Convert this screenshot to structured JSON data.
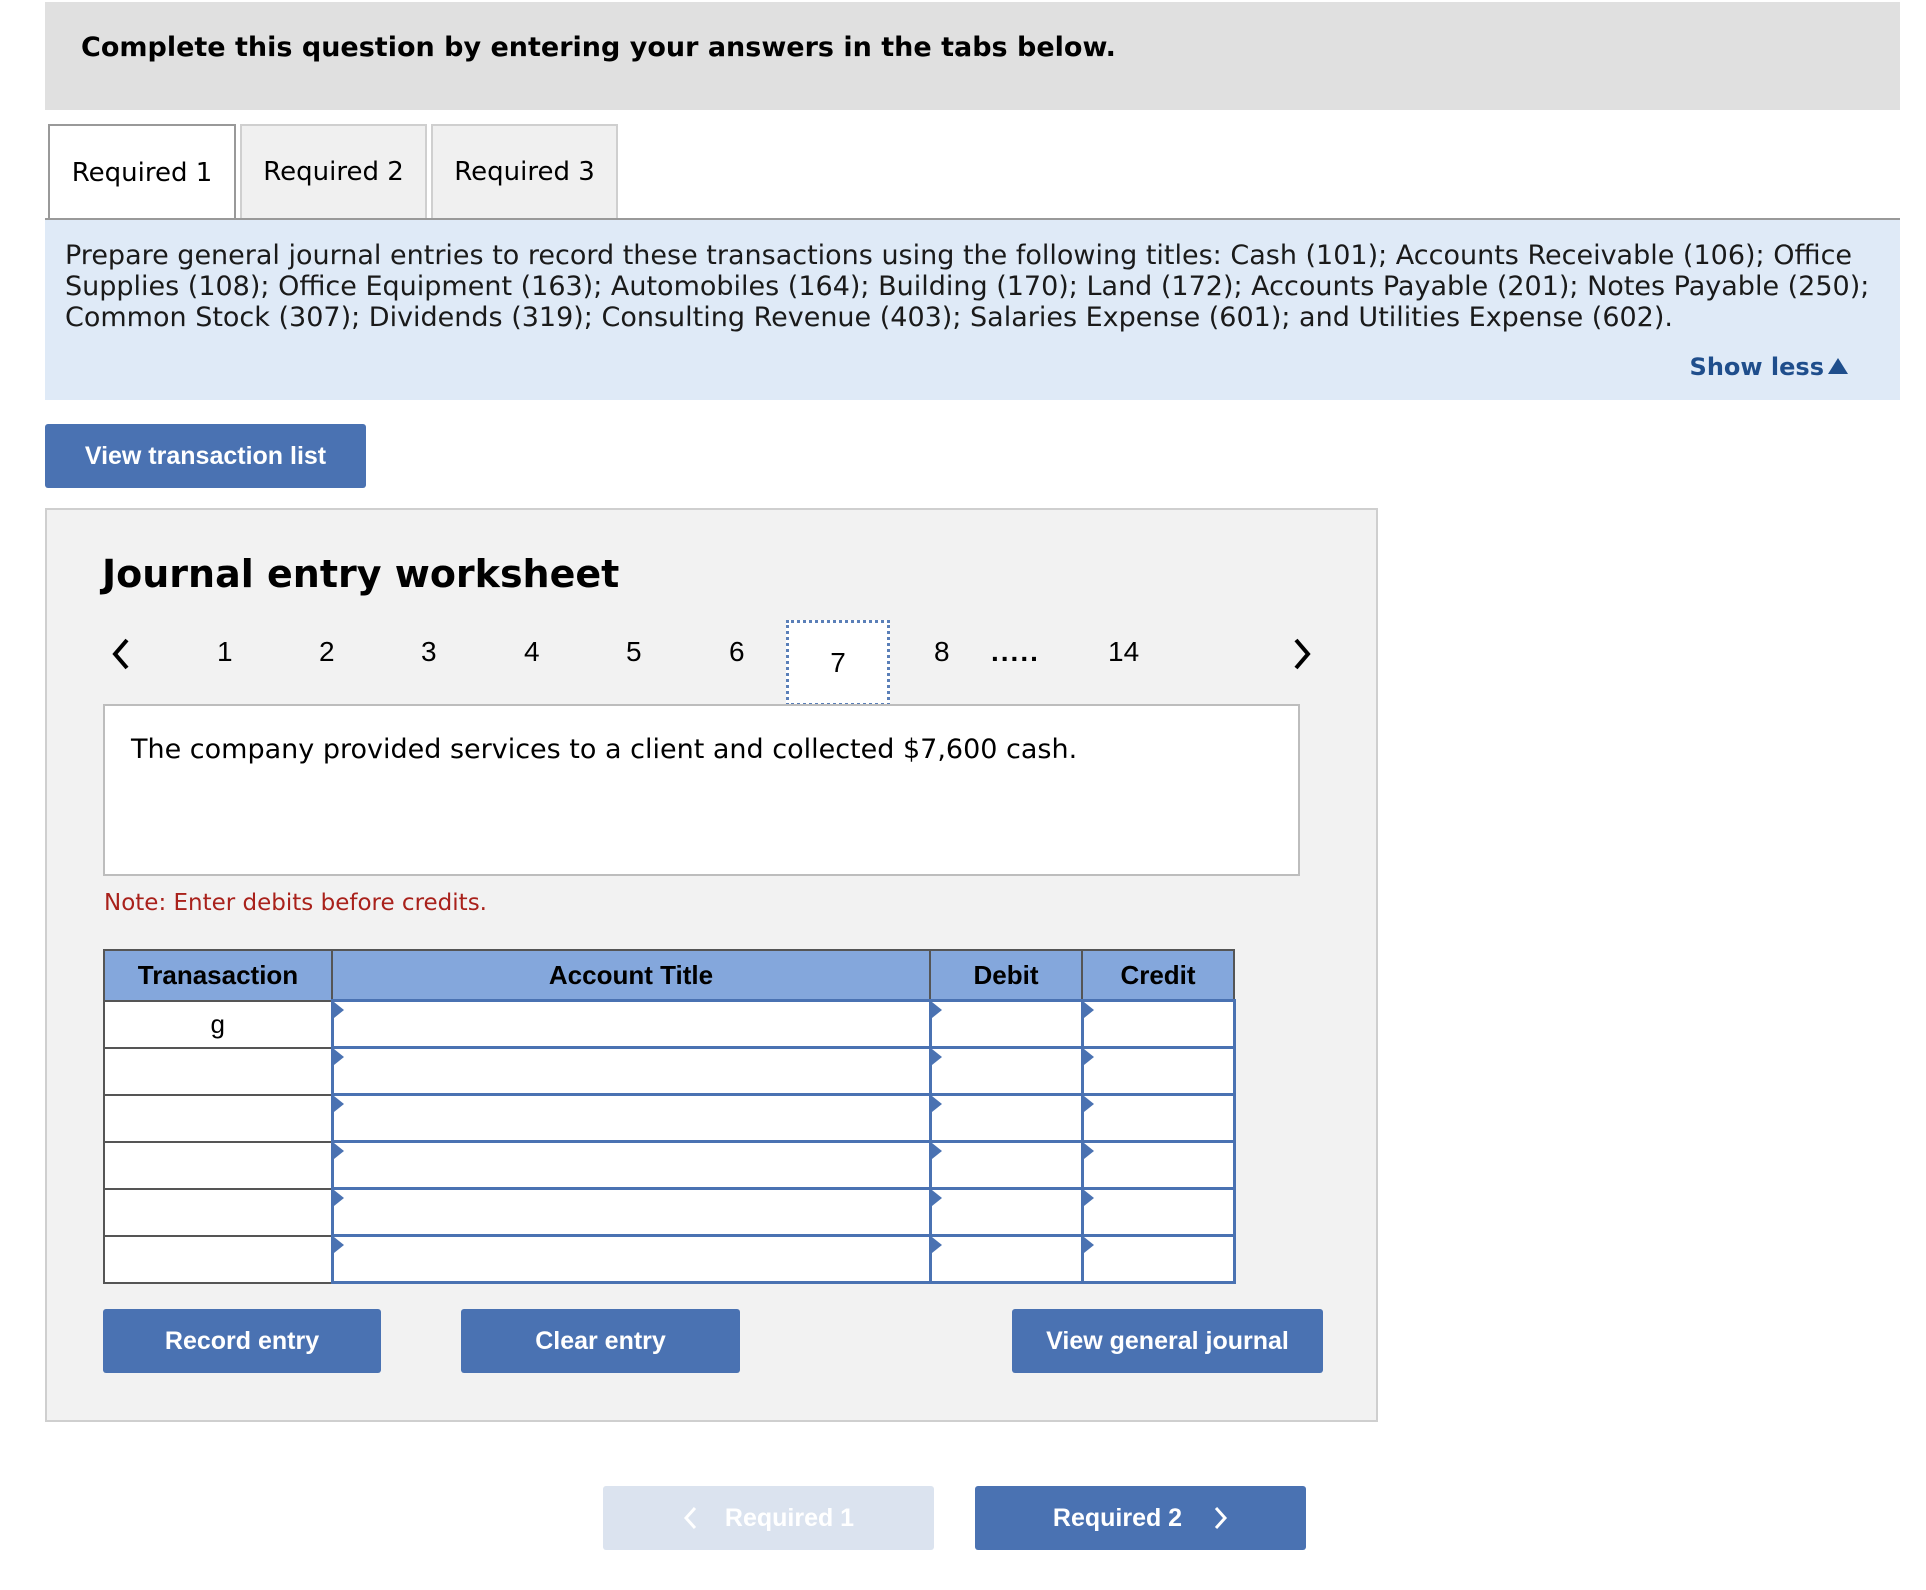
{
  "header": {
    "text": "Complete this question by entering your answers in the tabs below."
  },
  "tabs": [
    {
      "label": "Required 1",
      "active": true
    },
    {
      "label": "Required 2",
      "active": false
    },
    {
      "label": "Required 3",
      "active": false
    }
  ],
  "instructions": {
    "text": "Prepare general journal entries to record these transactions using the following titles: Cash (101); Accounts Receivable (106); Office Supplies (108); Office Equipment (163); Automobiles (164); Building (170); Land (172); Accounts Payable (201); Notes Payable (250); Common Stock (307); Dividends (319); Consulting Revenue (403); Salaries Expense (601); and Utilities Expense (602).",
    "toggle_label": "Show less"
  },
  "view_transactions_label": "View transaction list",
  "worksheet": {
    "title": "Journal entry worksheet",
    "pages": [
      "1",
      "2",
      "3",
      "4",
      "5",
      "6",
      "7",
      "8",
      ".....",
      "14"
    ],
    "current_page": "7",
    "description": "The company provided services to a client and collected $7,600 cash.",
    "note": "Note: Enter debits before credits.",
    "table": {
      "headers": {
        "transaction": "Tranasaction",
        "account": "Account Title",
        "debit": "Debit",
        "credit": "Credit"
      },
      "rows": [
        {
          "transaction": "g",
          "account": "",
          "debit": "",
          "credit": ""
        },
        {
          "transaction": "",
          "account": "",
          "debit": "",
          "credit": ""
        },
        {
          "transaction": "",
          "account": "",
          "debit": "",
          "credit": ""
        },
        {
          "transaction": "",
          "account": "",
          "debit": "",
          "credit": ""
        },
        {
          "transaction": "",
          "account": "",
          "debit": "",
          "credit": ""
        },
        {
          "transaction": "",
          "account": "",
          "debit": "",
          "credit": ""
        }
      ]
    },
    "buttons": {
      "record": "Record entry",
      "clear": "Clear entry",
      "view_journal": "View general journal"
    }
  },
  "footer_nav": {
    "prev_label": "Required 1",
    "next_label": "Required 2"
  },
  "colors": {
    "button": "#4a72b2",
    "header_bg": "#e0e0e0",
    "instructions_bg": "#dfeaf7",
    "table_header": "#84a7dc",
    "note": "#a9211b"
  }
}
